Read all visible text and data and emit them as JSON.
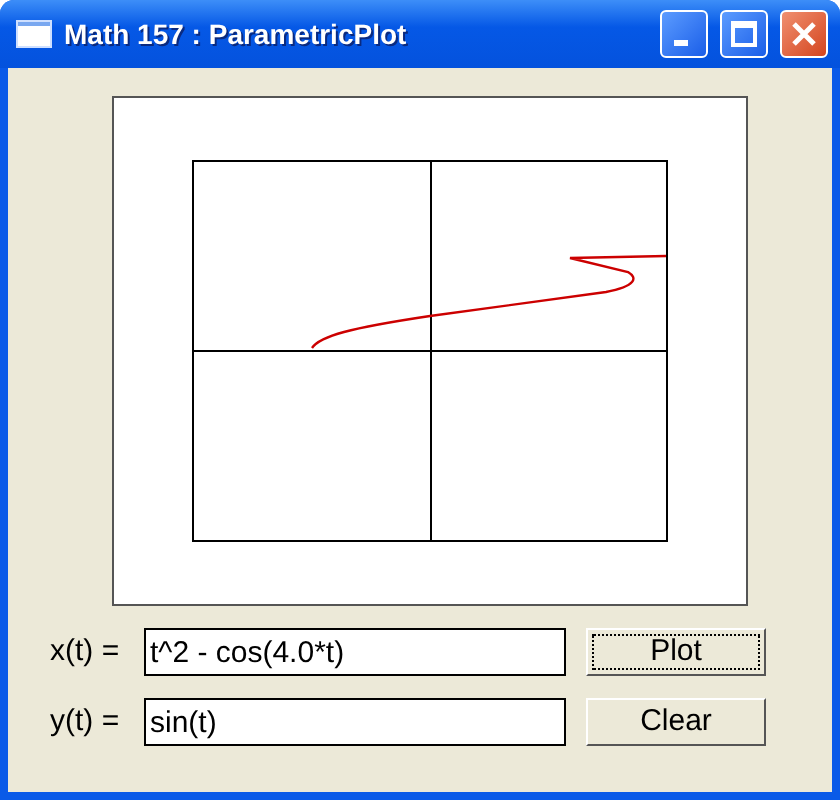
{
  "window": {
    "title": "Math 157 : ParametricPlot"
  },
  "fields": [
    {
      "label": "x(t) =",
      "value": "t^2 - cos(4.0*t)"
    },
    {
      "label": "y(t) =",
      "value": "sin(t)"
    }
  ],
  "buttons": [
    {
      "label": "Plot",
      "focused": true
    },
    {
      "label": "Clear",
      "focused": false
    }
  ]
}
